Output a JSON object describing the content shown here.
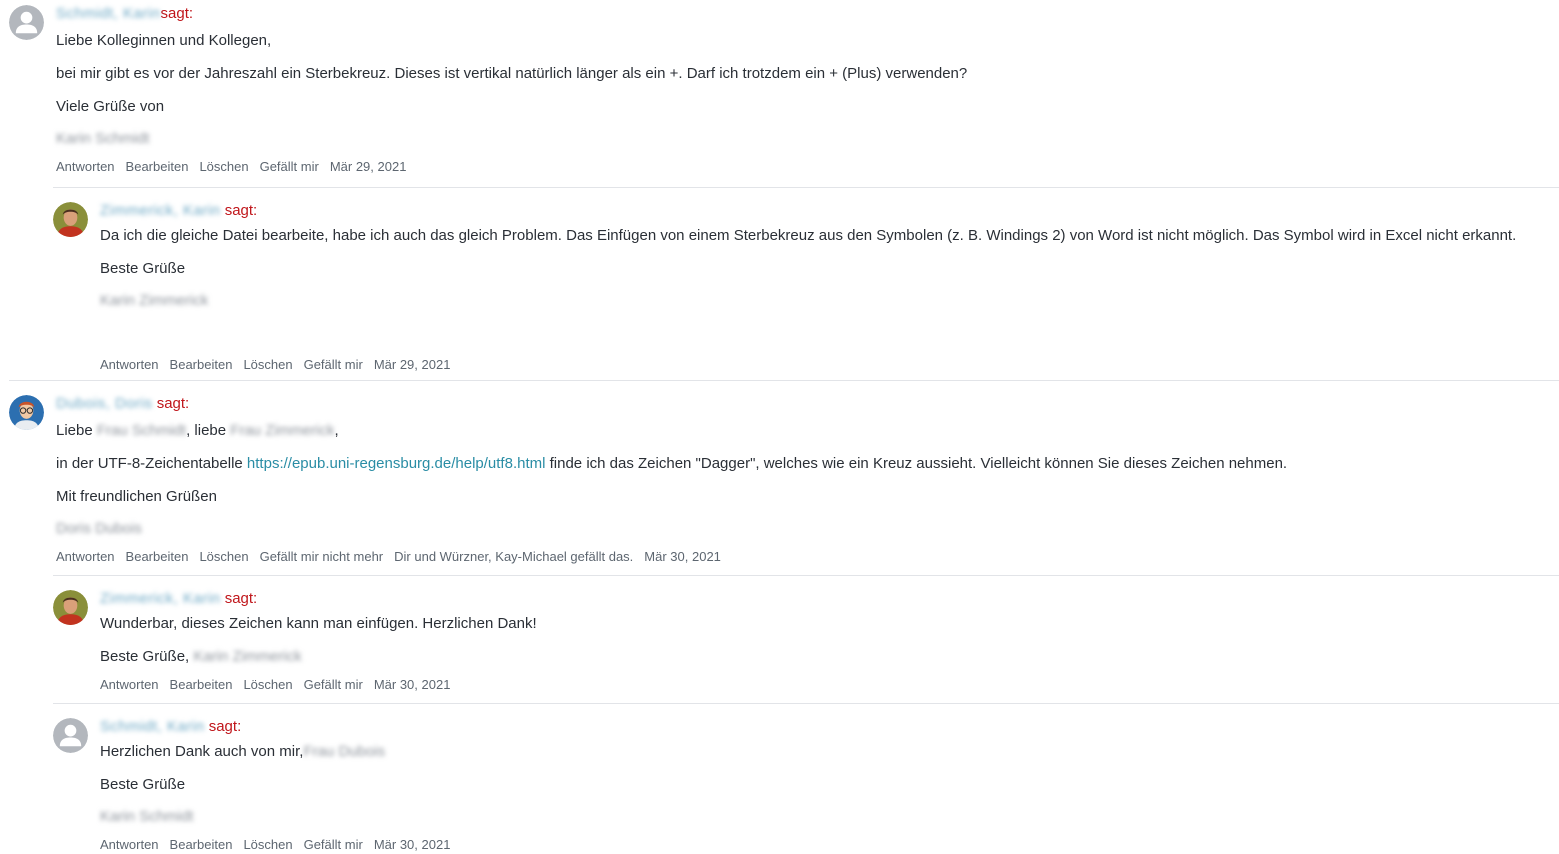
{
  "sagt": "sagt:",
  "actions": {
    "reply": "Antworten",
    "edit": "Bearbeiten",
    "delete": "Löschen",
    "like": "Gefällt mir",
    "unlike": "Gefällt mir nicht mehr"
  },
  "comments": [
    {
      "author": "Schmidt, Karin",
      "line1": "Liebe Kolleginnen und Kollegen,",
      "line2": "bei mir gibt es vor der Jahreszahl ein Sterbekreuz. Dieses ist vertikal natürlich länger als ein +. Darf ich trotzdem ein + (Plus) verwenden?",
      "line3": "Viele Grüße von",
      "signature": "Karin Schmidt",
      "date": "Mär 29, 2021"
    },
    {
      "author": "Zimmerick, Karin",
      "line1": "Da ich die gleiche Datei bearbeite, habe ich auch das gleich Problem. Das Einfügen von einem Sterbekreuz aus den Symbolen (z. B. Windings 2) von Word ist nicht möglich. Das Symbol wird in Excel nicht erkannt.",
      "line2": "Beste Grüße",
      "signature": "Karin Zimmerick",
      "date": "Mär 29, 2021"
    },
    {
      "author": "Dubois, Doris",
      "greeting_start": "Liebe",
      "name_a": "Frau Schmidt",
      "greeting_mid": ", liebe",
      "name_b": "Frau Zimmerick",
      "greeting_end": ",",
      "line2_pre": "in der UTF-8-Zeichentabelle",
      "link": "https://epub.uni-regensburg.de/help/utf8.html",
      "line2_post": "finde ich das Zeichen \"Dagger\", welches wie ein Kreuz aussieht. Vielleicht können Sie dieses Zeichen nehmen.",
      "line3": "Mit freundlichen Grüßen",
      "signature": "Doris Dubois",
      "likes_text": "Dir und Würzner, Kay-Michael gefällt das.",
      "date": "Mär 30, 2021"
    },
    {
      "author": "Zimmerick, Karin",
      "line1": "Wunderbar, dieses Zeichen kann man einfügen. Herzlichen Dank!",
      "line2_pre": "Beste Grüße,",
      "line2_name": "Karin Zimmerick",
      "date": "Mär 30, 2021"
    },
    {
      "author": "Schmidt, Karin",
      "line1_pre": "Herzlichen Dank auch von mir,",
      "line1_name": "Frau Dubois",
      "line2": "Beste Grüße",
      "signature": "Karin Schmidt",
      "date": "Mär 30, 2021"
    }
  ],
  "colors": {
    "sagt": "#c0161b",
    "link": "#2a8da5",
    "author_link": "#6ba7c4",
    "meta": "#5d6670",
    "divider": "#e2e4e8"
  }
}
